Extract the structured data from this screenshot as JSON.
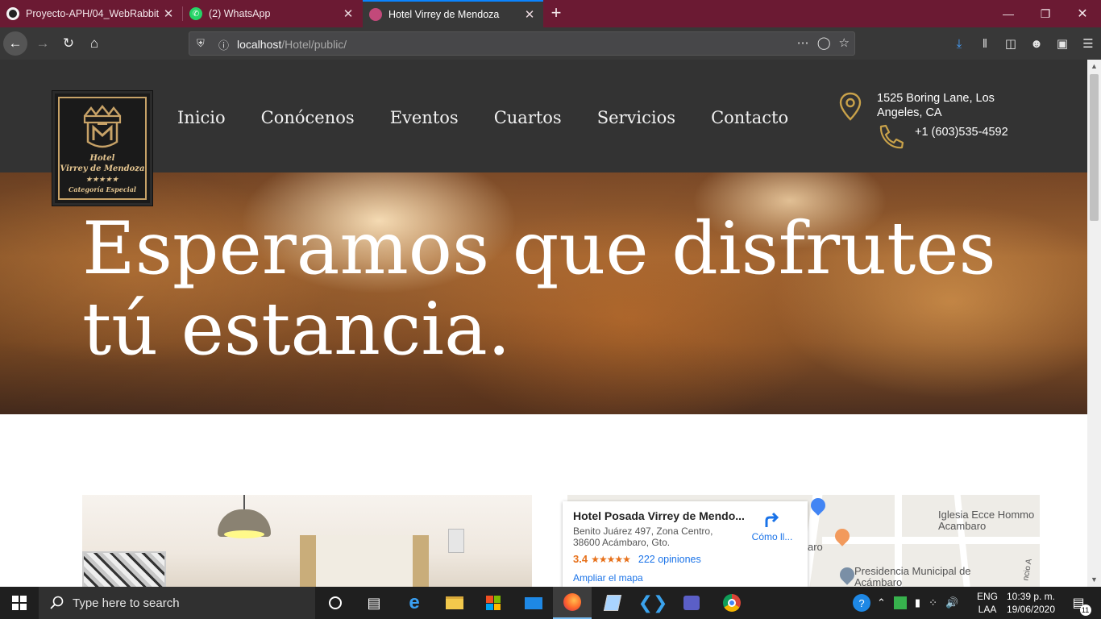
{
  "browser": {
    "tabs": [
      {
        "title": "Proyecto-APH/04_WebRabbit a",
        "favicon": "github-icon",
        "active": false
      },
      {
        "title": "(2) WhatsApp",
        "favicon": "whatsapp-icon",
        "active": false
      },
      {
        "title": "Hotel Virrey de Mendoza",
        "favicon": "hotel-favicon",
        "active": true
      }
    ],
    "url_host": "localhost",
    "url_path": "/Hotel/public/"
  },
  "site": {
    "logo": {
      "line1": "Hotel",
      "line2": "Virrey de Mendoza",
      "line3": "★★★★★",
      "line4": "Categoría Especial"
    },
    "menu": [
      "Inicio",
      "Conócenos",
      "Eventos",
      "Cuartos",
      "Servicios",
      "Contacto"
    ],
    "address": "1525 Boring Lane, Los Angeles, CA",
    "phone": "+1 (603)535-4592",
    "hero_line1": "Esperamos que disfrutes",
    "hero_line2": "tú estancia.",
    "accent_color": "#c9a24a"
  },
  "map": {
    "place_name": "Hotel Posada Virrey de Mendo...",
    "place_address": "Benito Juárez 497, Zona Centro, 38600 Acámbaro, Gto.",
    "rating": "3.4",
    "stars": "★★★★★",
    "reviews": "222 opiniones",
    "directions": "Cómo ll...",
    "enlarge": "Ampliar el mapa",
    "label_church": "Iglesia Ecce Hommo Acambaro",
    "label_presidency": "Presidencia Municipal de Acámbaro",
    "label_partial": "aro",
    "label_street": "ncio A"
  },
  "taskbar": {
    "search_placeholder": "Type here to search",
    "lang_line1": "ENG",
    "lang_line2": "LAA",
    "time": "10:39 p. m.",
    "date": "19/06/2020",
    "notification_count": "11"
  }
}
